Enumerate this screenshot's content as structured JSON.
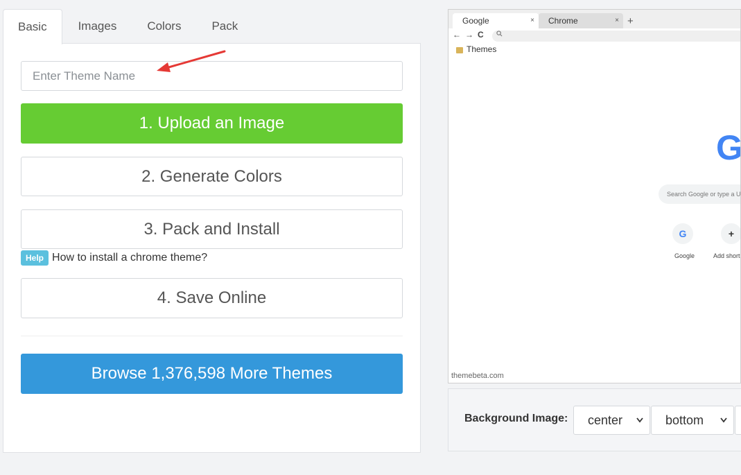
{
  "tabs": [
    {
      "label": "Basic",
      "active": true
    },
    {
      "label": "Images",
      "active": false
    },
    {
      "label": "Colors",
      "active": false
    },
    {
      "label": "Pack",
      "active": false
    }
  ],
  "theme_name_input": {
    "placeholder": "Enter Theme Name",
    "value": ""
  },
  "buttons": {
    "upload": "1. Upload an Image",
    "generate": "2. Generate Colors",
    "pack": "3. Pack and Install",
    "save": "4. Save Online",
    "browse": "Browse 1,376,598 More Themes"
  },
  "help": {
    "badge": "Help",
    "link": "How to install a chrome theme?"
  },
  "colors": {
    "upload_button": "#66cc33",
    "browse_button": "#3498db",
    "help_badge": "#5bc0de",
    "annotation_arrow": "#e53935"
  },
  "preview": {
    "tabs": [
      {
        "label": "Google",
        "close": "×"
      },
      {
        "label": "Chrome",
        "close": "×"
      }
    ],
    "new_tab": "+",
    "nav_icons": [
      "←",
      "→",
      "C"
    ],
    "bookmark": "Themes",
    "logo_letter": "G",
    "search_placeholder": "Search Google or type a URL",
    "shortcuts": [
      {
        "icon": "G",
        "label": "Google"
      },
      {
        "icon": "+",
        "label": "Add shortcut"
      }
    ],
    "watermark": "themebeta.com"
  },
  "background_image": {
    "label": "Background Image:",
    "horizontal": "center",
    "vertical": "bottom"
  }
}
